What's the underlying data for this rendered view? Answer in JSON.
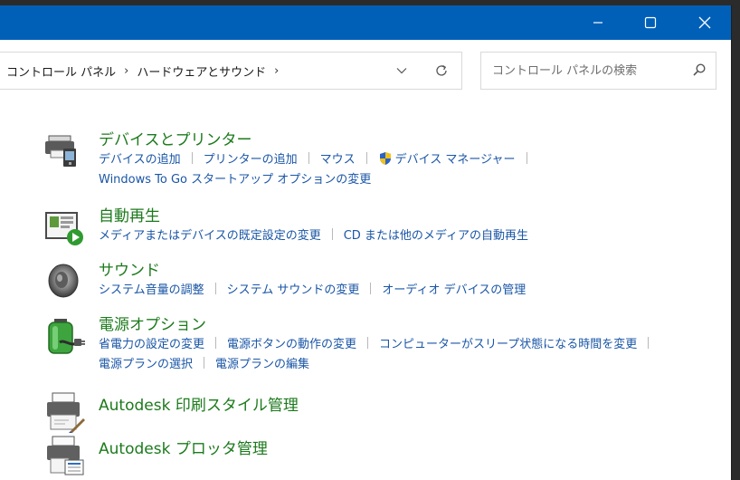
{
  "colors": {
    "title": "#0060b8",
    "green": "#1c7a1c",
    "link": "#1a56a6"
  },
  "breadcrumb": [
    "コントロール パネル",
    "ハードウェアとサウンド"
  ],
  "search": {
    "placeholder": "コントロール パネルの検索"
  },
  "categories": [
    {
      "title": "デバイスとプリンター",
      "links": [
        "デバイスの追加",
        "プリンターの追加",
        "マウス",
        "デバイス マネージャー"
      ],
      "links2": [
        "Windows To Go スタートアップ オプションの変更"
      ]
    },
    {
      "title": "自動再生",
      "links": [
        "メディアまたはデバイスの既定設定の変更",
        "CD または他のメディアの自動再生"
      ]
    },
    {
      "title": "サウンド",
      "links": [
        "システム音量の調整",
        "システム サウンドの変更",
        "オーディオ デバイスの管理"
      ]
    },
    {
      "title": "電源オプション",
      "links": [
        "省電力の設定の変更",
        "電源ボタンの動作の変更",
        "コンピューターがスリープ状態になる時間を変更"
      ],
      "links2": [
        "電源プランの選択",
        "電源プランの編集"
      ]
    },
    {
      "title": "Autodesk 印刷スタイル管理"
    },
    {
      "title": "Autodesk プロッタ管理"
    }
  ]
}
